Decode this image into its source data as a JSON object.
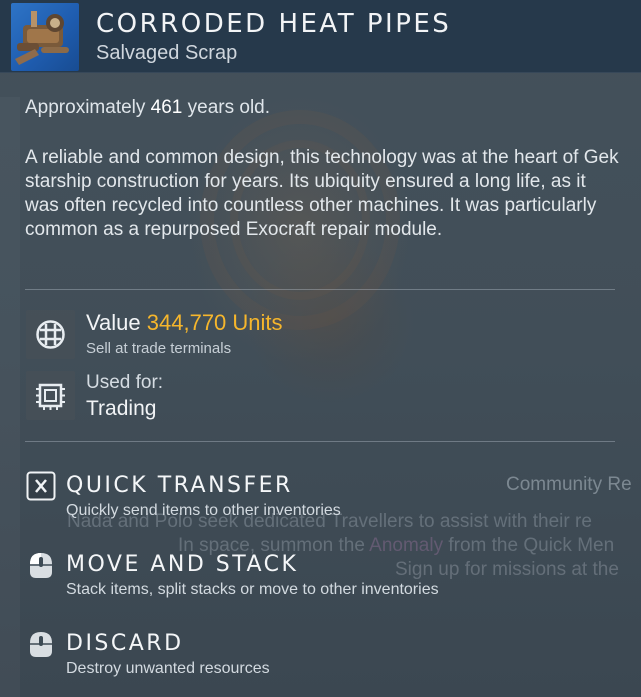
{
  "item": {
    "title": "CORRODED HEAT PIPES",
    "category": "Salvaged Scrap",
    "icon": "corroded-heat-pipes-icon"
  },
  "age": {
    "prefix": "Approximately",
    "years": "461",
    "suffix": "years old."
  },
  "description": "A reliable and common design, this technology was at the heart of Gek starship construction for years. Its ubiquity ensured a long life, as it was often recycled into countless other machines. It was particularly common as a repurposed Exocraft repair module.",
  "value": {
    "label": "Value",
    "amount": "344,770 Units",
    "sub": "Sell at trade terminals",
    "icon": "units-currency-icon"
  },
  "used_for": {
    "label": "Used for:",
    "value": "Trading",
    "icon": "trade-chip-icon"
  },
  "actions": [
    {
      "title": "QUICK TRANSFER",
      "sub": "Quickly send items to other inventories",
      "icon": "x-key-icon"
    },
    {
      "title": "MOVE AND STACK",
      "sub": "Stack items, split stacks or move to other inventories",
      "icon": "mouse-left-click-icon"
    },
    {
      "title": "DISCARD",
      "sub": "Destroy unwanted resources",
      "icon": "mouse-hold-icon"
    }
  ],
  "background": {
    "community_label": "Community Re",
    "line1": "Nada and Polo seek dedicated Travellers to assist with their re",
    "line2_a": "In space, summon the",
    "line2_accent": "Anomaly",
    "line2_b": "from the Quick Men",
    "line3": "Sign up for missions at the"
  },
  "colors": {
    "header_bg": "#26394b",
    "value_accent": "#f6b62c",
    "icon_bg": "#1f5db0"
  }
}
